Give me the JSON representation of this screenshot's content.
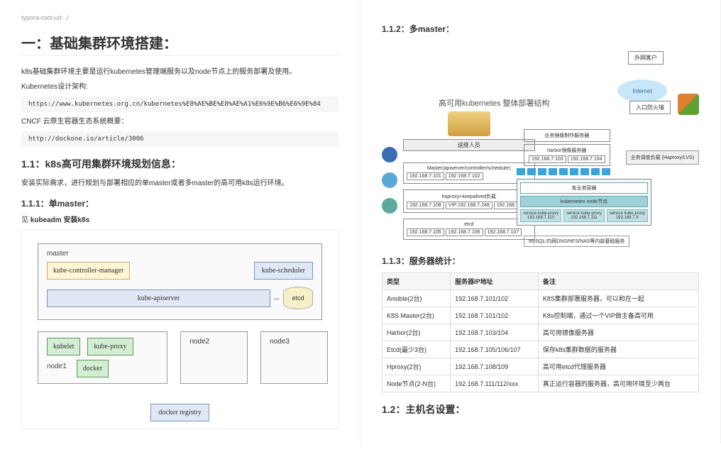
{
  "meta": "typora-root-url: ./",
  "h1": "一：基础集群环境搭建：",
  "intro1": "k8s基础集群环境主要是运行kubernetes管理端服务以及node节点上的服务部署及使用。",
  "intro2": "Kubernetes设计架构:",
  "url1": "https://www.kubernetes.org.cn/kubernetes%E8%AE%BE%E8%AE%A1%E6%9E%B6%E6%9E%84",
  "intro3": "CNCF 云原生容器生态系统概要：",
  "url2": "http://dockone.io/article/3006",
  "h11": "1.1：k8s高可用集群环境规划信息：",
  "p11": "安装实际需求，进行规划与部署相应的单master或者多master的高可用k8s运行环境。",
  "h111": "1.1.1：单master：",
  "p111": "见 kubeadm 安装k8s",
  "diagram1": {
    "master_title": "master",
    "kcm": "kube-controller-manager",
    "ksched": "kube-scheduler",
    "kapi": "kube-apiserver",
    "etcd": "etcd",
    "node1": "node1",
    "node2": "node2",
    "node3": "node3",
    "kubelet": "kubelet",
    "kproxy": "kube-proxy",
    "docker": "docker",
    "registry": "docker registry"
  },
  "h112": "1.1.2：多master：",
  "mm": {
    "title": "高可用kubernetes 整体部署结构",
    "external": "外网客户",
    "internet": "Internet",
    "firewall": "入口防火墙",
    "lb": "业务调度负载 (Haproxy/LVS)",
    "ops": "运维人员",
    "master_label": "Master(apiserver/controller/scheduler)",
    "master_ips": [
      "192.168.7.101",
      "192.168.7.102"
    ],
    "haproxy": "haproxy+keepalived负载",
    "haproxy_ips": [
      "192.168.7.108",
      "VIP:192.168.7.248",
      "192.168.7.109"
    ],
    "etcd": "etcd",
    "etcd_ips": [
      "192.168.7.105",
      "192.168.7.106",
      "192.168.7.107"
    ],
    "svc_repo": "业务镜像制作服务器",
    "harbor_label": "harbor镜像服务器",
    "harbor_ips": [
      "192.168.7.103",
      "192.168.7.104"
    ],
    "biz": "各业务容器",
    "node_title": "kubernetes  node节点",
    "pod_labels": [
      "service\nkube-proxy\n192.168.7.110",
      "service\nkube-proxy\n192.168.7.111",
      "service\nkube-proxy\n192.168.7.X"
    ],
    "mysql": "MySQL/内网DNS/NFS/NAS等内部基础服务"
  },
  "h113": "1.1.3：服务器统计：",
  "table": {
    "headers": [
      "类型",
      "服务器IP地址",
      "备注"
    ],
    "rows": [
      [
        "Ansible(2台)",
        "192.168.7.101/102",
        "K8S集群部署服务器，可以和在一起"
      ],
      [
        "K8S Master(2台)",
        "192.168.7.101/102",
        "K8s控制端，通过一个VIP做主备高可用"
      ],
      [
        "Harbor(2台)",
        "192.168.7.103/104",
        "高可用镜像服务器"
      ],
      [
        "Etcd(最少3台)",
        "192.168.7.105/106/107",
        "保存k8s集群数据的服务器"
      ],
      [
        "Hproxy(2台)",
        "192.168.7.108/109",
        "高可用etcd代理服务器"
      ],
      [
        "Node节点(2-N台)",
        "192.168.7.111/112/xxx",
        "真正运行容器的服务器，高可用环境至少两台"
      ]
    ]
  },
  "h12": "1.2：主机名设置："
}
